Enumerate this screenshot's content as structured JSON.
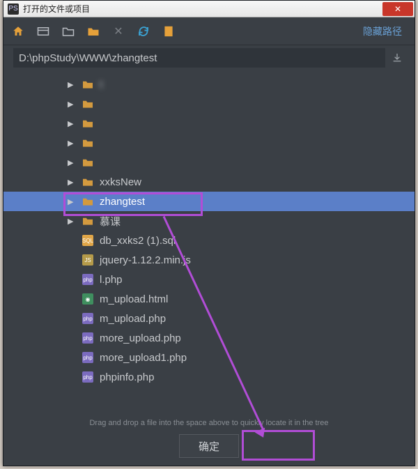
{
  "title": "打开的文件或项目",
  "titlebar_icon": "PS",
  "close_glyph": "✕",
  "toolbar": {
    "hide_path": "隐藏路径"
  },
  "path": "D:\\phpStudy\\WWW\\zhangtest",
  "tree": [
    {
      "kind": "folder",
      "expandable": true,
      "label": "t",
      "blurred": true
    },
    {
      "kind": "folder",
      "expandable": true,
      "label": "",
      "blurred": true
    },
    {
      "kind": "folder",
      "expandable": true,
      "label": "",
      "blurred": true
    },
    {
      "kind": "folder",
      "expandable": true,
      "label": "",
      "blurred": true
    },
    {
      "kind": "folder",
      "expandable": true,
      "label": "",
      "blurred": true
    },
    {
      "kind": "folder",
      "expandable": true,
      "label": "xxksNew",
      "blurred": false
    },
    {
      "kind": "folder",
      "expandable": true,
      "label": "zhangtest",
      "blurred": false,
      "selected": true
    },
    {
      "kind": "folder",
      "expandable": true,
      "label": "慕课",
      "blurred": false
    },
    {
      "kind": "file",
      "ext": "sql",
      "label": "db_xxks2 (1).sql"
    },
    {
      "kind": "file",
      "ext": "js",
      "label": "jquery-1.12.2.min.js"
    },
    {
      "kind": "file",
      "ext": "php",
      "label": "l.php"
    },
    {
      "kind": "file",
      "ext": "html",
      "label": "m_upload.html"
    },
    {
      "kind": "file",
      "ext": "php",
      "label": "m_upload.php"
    },
    {
      "kind": "file",
      "ext": "php",
      "label": "more_upload.php"
    },
    {
      "kind": "file",
      "ext": "php",
      "label": "more_upload1.php"
    },
    {
      "kind": "file",
      "ext": "php",
      "label": "phpinfo.php"
    }
  ],
  "hint": "Drag and drop a file into the space above to quickly locate it in the tree",
  "ok_label": "确定"
}
